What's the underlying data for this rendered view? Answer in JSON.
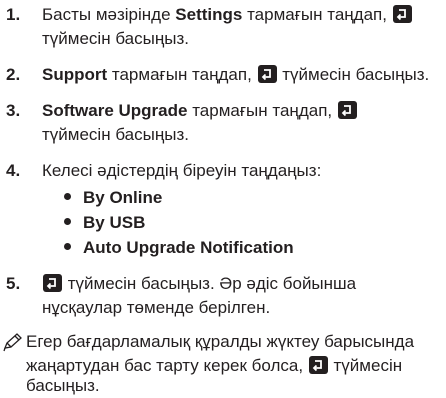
{
  "steps": [
    {
      "num": "1.",
      "line1_pre": "Басты мәзірінде ",
      "line1_bold": "Settings",
      "line1_post": " тармағын таңдап, ",
      "line2": "түймесін басыңыз."
    },
    {
      "num": "2.",
      "bold": "Support",
      "post": " тармағын таңдап, ",
      "post2": " түймесін басыңыз."
    },
    {
      "num": "3.",
      "bold": "Software Upgrade",
      "post": " тармағын таңдап, ",
      "line2": "түймесін басыңыз."
    },
    {
      "num": "4.",
      "text": "Келесі әдістердің біреуін таңдаңыз:"
    },
    {
      "num": "5.",
      "line1": " түймесін басыңыз. Әр әдіс бойынша",
      "line2": "нұсқаулар төменде берілген."
    }
  ],
  "methods": [
    "By Online",
    "By USB",
    "Auto Upgrade Notification"
  ],
  "note": {
    "line1": "Егер бағдарламалық құралды жүктеу барысында",
    "line2_pre": "жаңартудан бас тарту керек болса, ",
    "line2_post": " түймесін",
    "line3": "басыңыз."
  },
  "icons": {
    "enter": "enter-key-icon",
    "note": "pencil-note-icon"
  }
}
